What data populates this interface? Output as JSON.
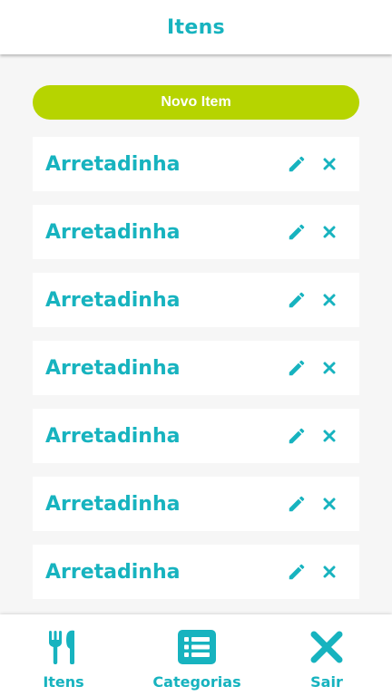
{
  "header": {
    "title": "Itens"
  },
  "actions": {
    "new_item_label": "Novo Item"
  },
  "items": [
    {
      "name": "Arretadinha"
    },
    {
      "name": "Arretadinha"
    },
    {
      "name": "Arretadinha"
    },
    {
      "name": "Arretadinha"
    },
    {
      "name": "Arretadinha"
    },
    {
      "name": "Arretadinha"
    },
    {
      "name": "Arretadinha"
    }
  ],
  "item_icons": {
    "edit": "pencil-icon",
    "delete": "close-icon"
  },
  "nav": [
    {
      "label": "Itens",
      "icon": "utensils-icon"
    },
    {
      "label": "Categorias",
      "icon": "list-icon"
    },
    {
      "label": "Sair",
      "icon": "close-icon"
    }
  ],
  "colors": {
    "accent": "#17b3bf",
    "button": "#b6d400",
    "background": "#f6f6f6",
    "surface": "#ffffff"
  }
}
